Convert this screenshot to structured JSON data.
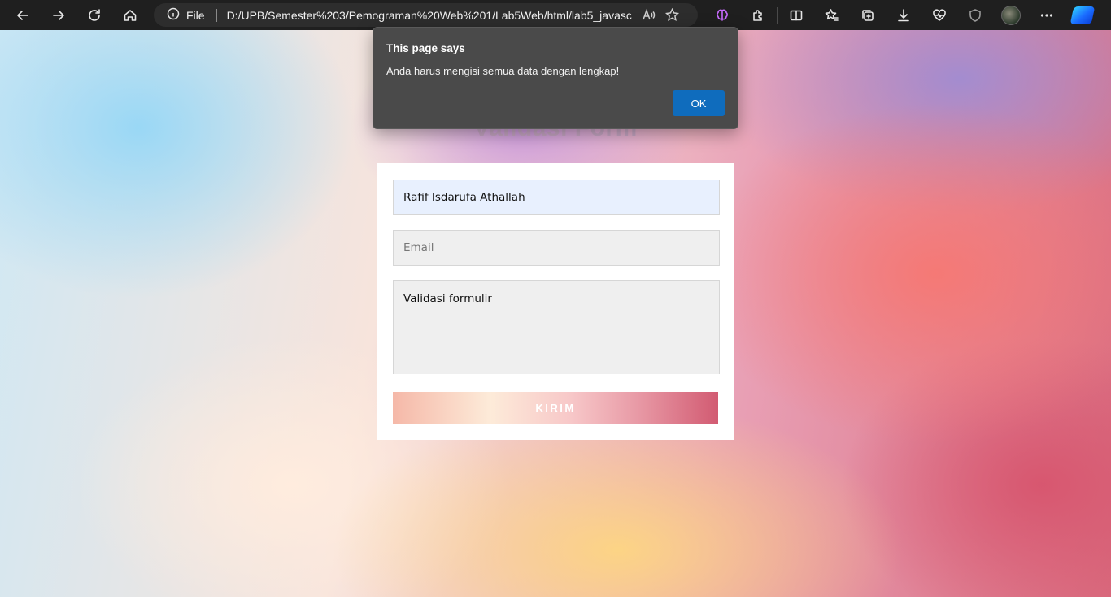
{
  "browser": {
    "scheme_label": "File",
    "url": "D:/UPB/Semester%203/Pemograman%20Web%201/Lab5Web/html/lab5_javasc..."
  },
  "page": {
    "heading": "Validasi Form"
  },
  "form": {
    "name_value": "Rafif Isdarufa Athallah",
    "email_placeholder": "Email",
    "message_value": "Validasi formulir",
    "submit_label": "KIRIM"
  },
  "dialog": {
    "title": "This page says",
    "message": "Anda harus mengisi semua data dengan lengkap!",
    "ok_label": "OK"
  }
}
